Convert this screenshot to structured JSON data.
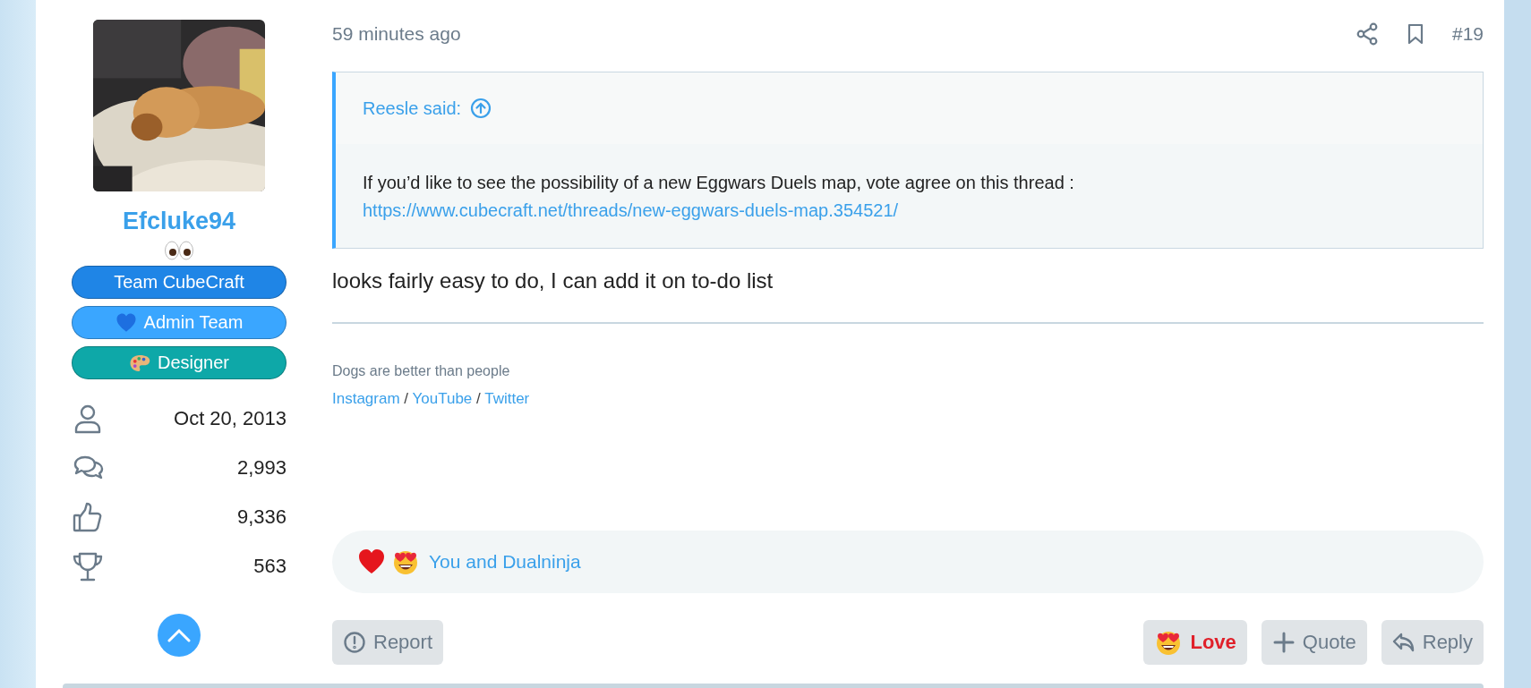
{
  "author": {
    "name": "Efcluke94",
    "badges": [
      {
        "label": "Team CubeCraft",
        "color": "#1f85e6"
      },
      {
        "label": "Admin Team",
        "color": "#3aa6ff"
      },
      {
        "label": "Designer",
        "color": "#0ea8a8"
      }
    ],
    "stats": [
      {
        "kind": "joined",
        "value": "Oct 20, 2013"
      },
      {
        "kind": "messages",
        "value": "2,993"
      },
      {
        "kind": "reactions",
        "value": "9,336"
      },
      {
        "kind": "points",
        "value": "563"
      }
    ]
  },
  "post": {
    "time": "59 minutes ago",
    "number": "#19",
    "quote": {
      "author": "Reesle said:",
      "text": "If you’d like to see the possibility of a new Eggwars Duels map, vote agree on this thread :",
      "link": "https://www.cubecraft.net/threads/new-eggwars-duels-map.354521/"
    },
    "body": "looks fairly easy to do, I can add it on to-do list",
    "signature": {
      "text": "Dogs are better than people",
      "links": [
        "Instagram",
        "YouTube",
        "Twitter"
      ],
      "separator": "/"
    },
    "reactions": {
      "users": "You and Dualninja"
    },
    "actions": [
      {
        "kind": "report",
        "label": "Report"
      },
      {
        "kind": "love",
        "label": "Love",
        "reacted": true
      },
      {
        "kind": "quote",
        "label": "Quote"
      },
      {
        "kind": "reply",
        "label": "Reply"
      }
    ]
  }
}
